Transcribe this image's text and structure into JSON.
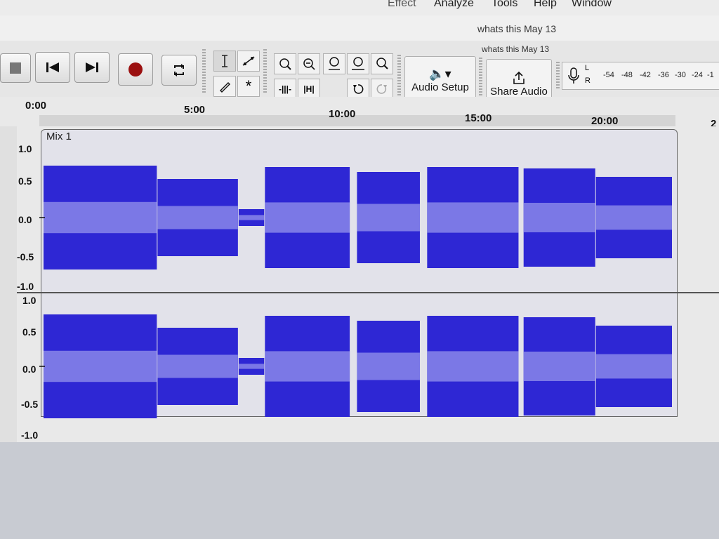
{
  "menu": {
    "items": [
      "Effect",
      "Analyze",
      "Tools",
      "Help",
      "Window"
    ]
  },
  "window": {
    "title": "whats this May 13",
    "project_title": "whats this May 13"
  },
  "transport": {
    "stop_icon": "stop-icon",
    "skip_start_icon": "skip-to-start-icon",
    "skip_end_icon": "skip-to-end-icon",
    "record_icon": "record-icon",
    "loop_icon": "loop-icon"
  },
  "tools": {
    "row1": [
      "selection-tool-icon",
      "envelope-tool-icon",
      "zoom-in-icon",
      "zoom-out-icon",
      "fit-selection-icon",
      "fit-project-icon",
      "zoom-toggle-icon"
    ],
    "row2": [
      "draw-tool-icon",
      "multi-tool-icon",
      "trim-audio-icon",
      "silence-audio-icon",
      "undo-icon",
      "redo-icon"
    ]
  },
  "audio_setup": {
    "label": "Audio Setup"
  },
  "share_audio": {
    "label": "Share Audio"
  },
  "meter": {
    "channels": [
      "L",
      "R"
    ],
    "ticks": [
      "-54",
      "-48",
      "-42",
      "-36",
      "-30",
      "-24",
      "-1"
    ]
  },
  "ruler": {
    "labels": [
      "0:00",
      "5:00",
      "10:00",
      "15:00",
      "20:00",
      "2"
    ]
  },
  "track": {
    "clip_name": "Mix 1",
    "channels": [
      {
        "scale": [
          "1.0",
          "0.5",
          "0.0",
          "-0.5",
          "-1.0"
        ]
      },
      {
        "scale": [
          "1.0",
          "0.5",
          "0.0",
          "-0.5",
          "-1.0"
        ]
      }
    ],
    "waveform_color": "#2e27d4",
    "rms_color": "#7b78e6",
    "segments_envelope": [
      0.74,
      0.55,
      0.12,
      0.72,
      0.65,
      0.72,
      0.7,
      0.58
    ],
    "segments_time": [
      [
        0,
        5.2
      ],
      [
        5.2,
        8.9
      ],
      [
        8.9,
        10.1
      ],
      [
        10.1,
        14.0
      ],
      [
        14.3,
        17.2
      ],
      [
        17.5,
        21.7
      ],
      [
        21.9,
        25.2
      ],
      [
        25.2,
        28.7
      ]
    ]
  },
  "colors": {
    "record": "#9b1010",
    "accent": "#2e27d4"
  }
}
